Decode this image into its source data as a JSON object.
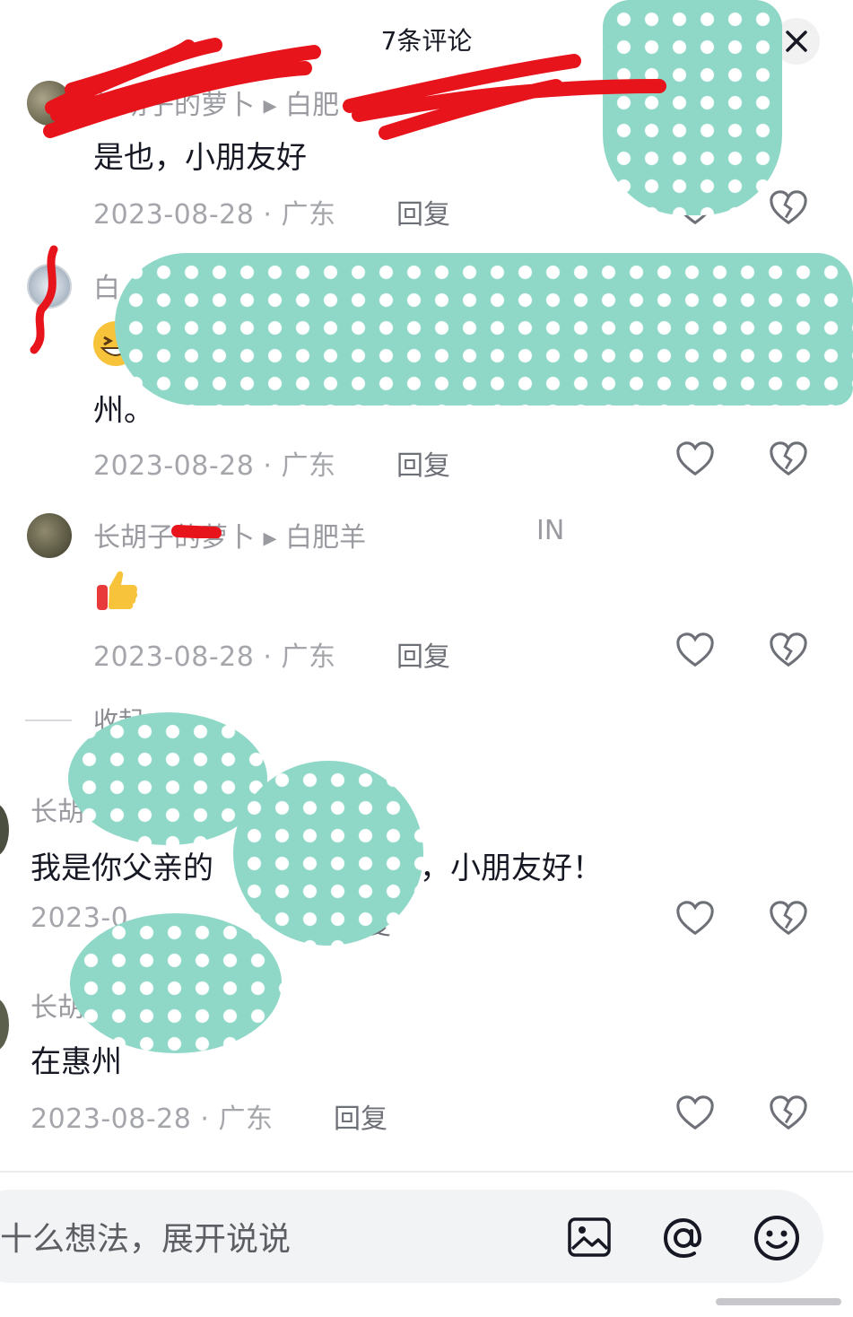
{
  "header": {
    "title": "7条评论",
    "close_icon": "close-icon"
  },
  "comments": [
    {
      "username": "长胡子的萝卜 ▸ 白肥",
      "text": "是也，小朋友好",
      "date": "2023-08-28",
      "location": "广东",
      "reply_label": "回复"
    },
    {
      "username": "白",
      "emoji": "grinning-squint-emoji",
      "text": "州。",
      "date": "2023-08-28",
      "location": "广东",
      "reply_label": "回复"
    },
    {
      "username": "长胡子的萝卜 ▸ 白肥羊",
      "emoji": "thumbs-up-emoji",
      "suffix": "IN",
      "date": "2023-08-28",
      "location": "广东",
      "reply_label": "回复"
    },
    {
      "username": "长胡",
      "text_pre": "我是你父亲的",
      "text_post": "，小朋友好！",
      "date_partial": "2023-0",
      "reply_partial": "复"
    },
    {
      "username": "长胡",
      "text": "在惠州",
      "date": "2023-08-28",
      "location": "广东",
      "reply_label": "回复"
    }
  ],
  "collapse_label": "收起",
  "separator": "·",
  "input": {
    "placeholder": "十么想法，展开说说",
    "image_icon": "image-icon",
    "mention_icon": "at-mention-icon",
    "emoji_icon": "emoji-face-icon"
  },
  "colors": {
    "mask": "#8fd8c8",
    "scribble": "#e8141c",
    "text_primary": "#161823",
    "text_secondary": "#a4a6ab"
  }
}
